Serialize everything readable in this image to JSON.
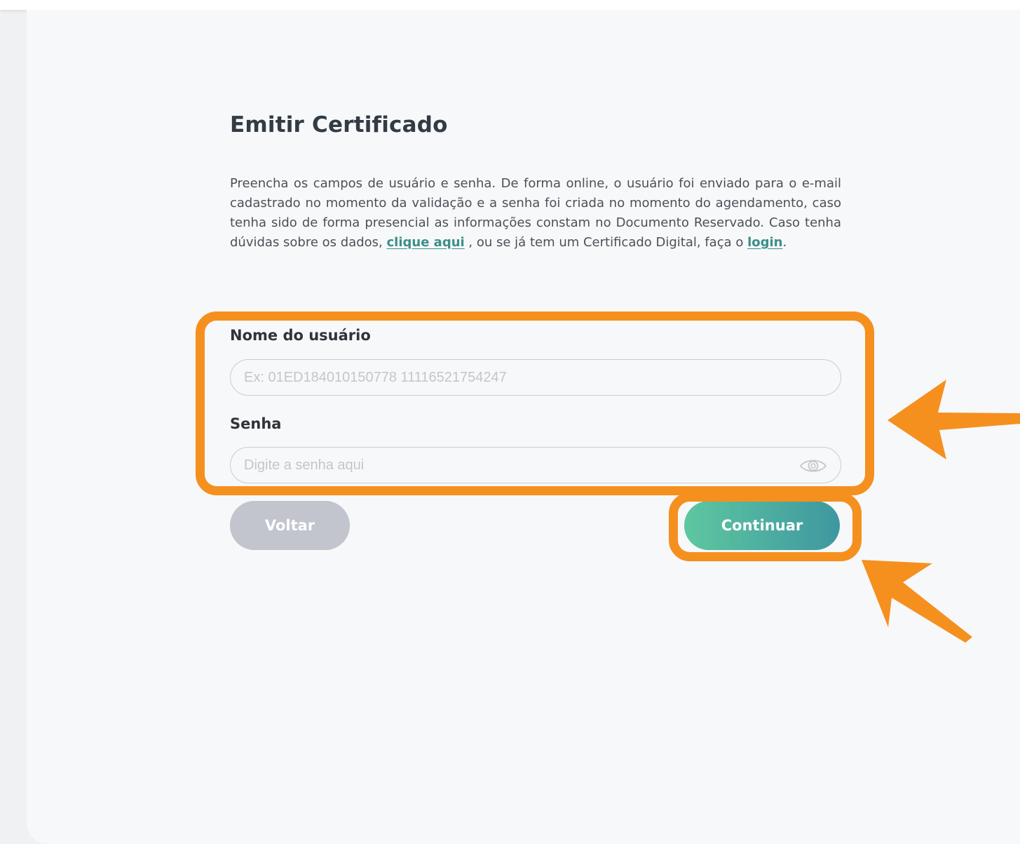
{
  "form": {
    "title": "Emitir Certificado",
    "description": {
      "text_1": "Preencha os campos de usuário e senha. De forma online, o usuário foi enviado para o e-mail cadastrado no momento da validação e a senha foi criada no momento do agendamento, caso tenha sido de forma presencial as informações constam no Documento Reservado. Caso tenha dúvidas sobre os dados, ",
      "link_help": "clique aqui",
      "text_2": " , ou se já tem um Certificado Digital, faça o ",
      "link_login": "login",
      "text_3": "."
    },
    "username": {
      "label": "Nome do usuário",
      "value": "",
      "placeholder": "Ex: 01ED184010150778 11116521754247"
    },
    "password": {
      "label": "Senha",
      "value": "",
      "placeholder": "Digite a senha aqui",
      "toggle_icon": "eye-icon"
    },
    "buttons": {
      "back_label": "Voltar",
      "continue_label": "Continuar"
    }
  },
  "annotations": {
    "highlight_color": "#f5901f",
    "arrow_color": "#f5901f"
  },
  "colors": {
    "link": "#3a8f8b",
    "back_button": "#c2c4ce",
    "continue_gradient_start": "#5ec7a0",
    "continue_gradient_end": "#3e97a0"
  }
}
